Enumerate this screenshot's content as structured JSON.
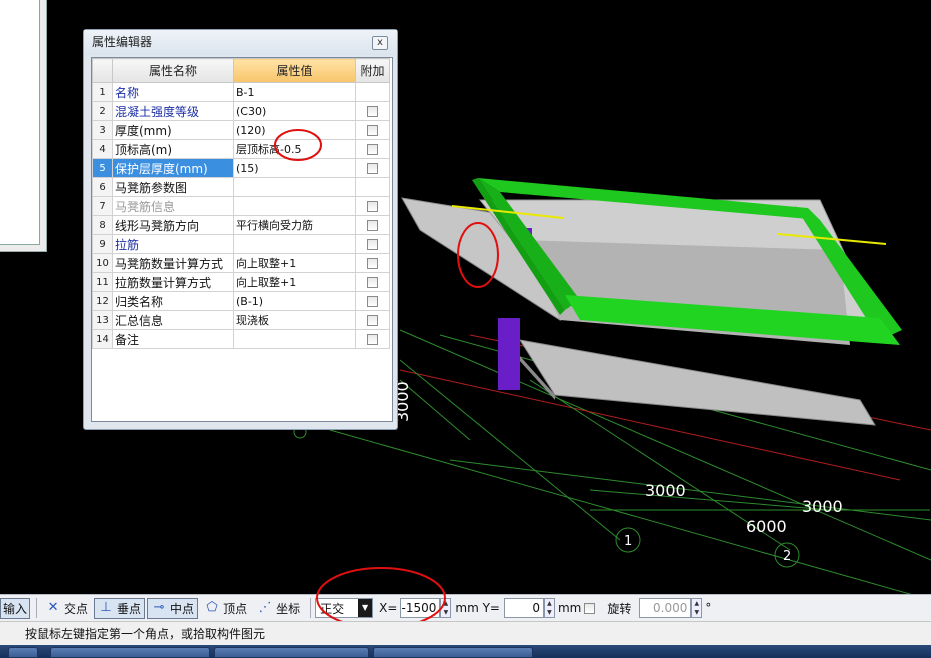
{
  "dialog": {
    "title": "属性编辑器",
    "close_label": "x",
    "columns": [
      "属性名称",
      "属性值",
      "附加"
    ],
    "rows": [
      {
        "num": "1",
        "name": "名称",
        "value": "B-1",
        "name_color": "blue",
        "has_check": false
      },
      {
        "num": "2",
        "name": "混凝土强度等级",
        "value": "(C30)",
        "name_color": "blue",
        "has_check": true
      },
      {
        "num": "3",
        "name": "厚度(mm)",
        "value": "(120)",
        "name_color": "blk",
        "has_check": true
      },
      {
        "num": "4",
        "name": "顶标高(m)",
        "value": "层顶标高-0.5",
        "name_color": "blk",
        "has_check": true
      },
      {
        "num": "5",
        "name": "保护层厚度(mm)",
        "value": "(15)",
        "name_color": "blk",
        "has_check": true,
        "selected": true
      },
      {
        "num": "6",
        "name": "马凳筋参数图",
        "value": "",
        "name_color": "blk",
        "has_check": false
      },
      {
        "num": "7",
        "name": "马凳筋信息",
        "value": "",
        "name_color": "gray",
        "has_check": true
      },
      {
        "num": "8",
        "name": "线形马凳筋方向",
        "value": "平行横向受力筋",
        "name_color": "blk",
        "has_check": true
      },
      {
        "num": "9",
        "name": "拉筋",
        "value": "",
        "name_color": "blue",
        "has_check": true
      },
      {
        "num": "10",
        "name": "马凳筋数量计算方式",
        "value": "向上取整+1",
        "name_color": "blk",
        "has_check": true
      },
      {
        "num": "11",
        "name": "拉筋数量计算方式",
        "value": "向上取整+1",
        "name_color": "blk",
        "has_check": true
      },
      {
        "num": "12",
        "name": "归类名称",
        "value": "(B-1)",
        "name_color": "blk",
        "has_check": true
      },
      {
        "num": "13",
        "name": "汇总信息",
        "value": "现浇板",
        "name_color": "blk",
        "has_check": true
      },
      {
        "num": "14",
        "name": "备注",
        "value": "",
        "name_color": "blk",
        "has_check": true
      }
    ]
  },
  "drawing": {
    "dimensions": [
      "3000",
      "3000",
      "3000",
      "6000"
    ],
    "axis_labels": [
      "1",
      "2"
    ]
  },
  "toolbar": {
    "input_label": "输入",
    "intersection_label": "交点",
    "perpendicular_label": "垂点",
    "midpoint_label": "中点",
    "vertex_label": "顶点",
    "coordinate_label": "坐标",
    "mode_value": "正交",
    "x_label": "X=",
    "x_value": "-1500",
    "y_label": "mm Y=",
    "y_value": "0",
    "mm_label": "mm",
    "rotate_label": "旋转",
    "rotate_value": "0.000",
    "degree_label": "°"
  },
  "status": {
    "text": "按鼠标左键指定第一个角点，或拾取构件图元"
  },
  "colors": {
    "beam_green": "#1ec81e",
    "slab_gray": "#c0c0c0",
    "grid_green": "#2e8b2e",
    "grid_red": "#b41e1e",
    "column_purple": "#6a1ec8",
    "annotation_red": "#e01010",
    "selection_blue": "#3b8fe0"
  }
}
